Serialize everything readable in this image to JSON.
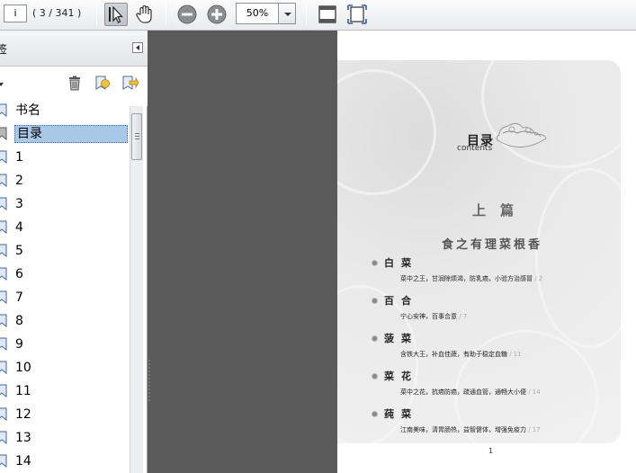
{
  "toolbar": {
    "page_input": "i",
    "page_count": "( 3 / 341 )",
    "zoom": "50%"
  },
  "panel": {
    "title": "签",
    "bookmarks": [
      {
        "label": "书名"
      },
      {
        "label": "目录"
      },
      {
        "label": "1"
      },
      {
        "label": "2"
      },
      {
        "label": "3"
      },
      {
        "label": "4"
      },
      {
        "label": "5"
      },
      {
        "label": "6"
      },
      {
        "label": "7"
      },
      {
        "label": "8"
      },
      {
        "label": "9"
      },
      {
        "label": "10"
      },
      {
        "label": "11"
      },
      {
        "label": "12"
      },
      {
        "label": "13"
      },
      {
        "label": "14"
      }
    ]
  },
  "page": {
    "heading": "目录",
    "heading_en": "contents",
    "section": "上篇",
    "subtitle": "食之有理菜根香",
    "entries": [
      {
        "name": "白菜",
        "desc": "菜中之王，甘润除烦渴，防乳癌，小验方治感冒",
        "page": " / 2"
      },
      {
        "name": "百合",
        "desc": "宁心安神，百事合意",
        "page": " / 7"
      },
      {
        "name": "菠菜",
        "desc": "含铁大王，补血佳蔬，有助于稳定血糖",
        "page": " / 11"
      },
      {
        "name": "菜花",
        "desc": "菜中之花，抗癌防癌，疏通血管，通畅大小便",
        "page": " / 14"
      },
      {
        "name": "莼菜",
        "desc": "江南美味，清胃肠热，益智健体，增强免疫力",
        "page": " / 17"
      }
    ],
    "page_number": "1"
  }
}
